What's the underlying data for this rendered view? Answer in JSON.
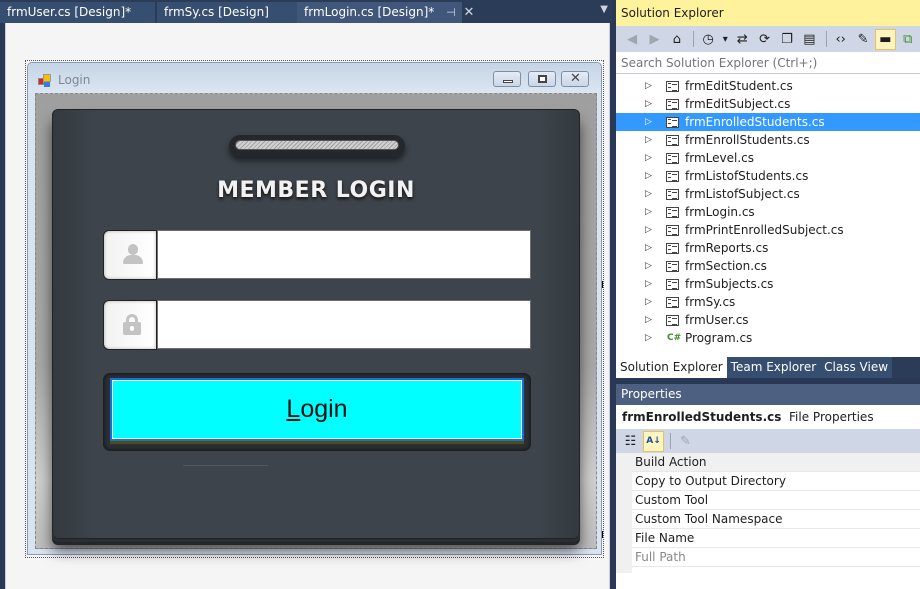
{
  "doc_tabs": [
    {
      "label": "frmUser.cs [Design]*",
      "active": false
    },
    {
      "label": "frmSy.cs [Design]",
      "active": false
    },
    {
      "label": "frmLogin.cs [Design]*",
      "active": true
    }
  ],
  "doc_tab_icons": {
    "pin": "pin-icon",
    "close": "close-icon",
    "overflow": "dropdown-icon"
  },
  "form": {
    "title": "Login",
    "heading": "MEMBER LOGIN",
    "username_value": "",
    "password_value": "",
    "login_button": {
      "mnemonic": "L",
      "rest": "ogin",
      "bg_color": "#00ffff"
    }
  },
  "solution_explorer": {
    "title": "Solution Explorer",
    "search_placeholder": "Search Solution Explorer (Ctrl+;)",
    "toolbar": [
      "back-icon",
      "forward-icon",
      "home-icon",
      "pending-changes-icon",
      "sync-icon",
      "refresh-icon",
      "collapse-all-icon",
      "show-all-files-icon",
      "view-code-icon",
      "properties-icon",
      "preview-icon",
      "class-diagram-icon"
    ],
    "items": [
      {
        "label": "frmEditStudent.cs",
        "type": "form",
        "selected": false
      },
      {
        "label": "frmEditSubject.cs",
        "type": "form",
        "selected": false
      },
      {
        "label": "frmEnrolledStudents.cs",
        "type": "form",
        "selected": true
      },
      {
        "label": "frmEnrollStudents.cs",
        "type": "form",
        "selected": false
      },
      {
        "label": "frmLevel.cs",
        "type": "form",
        "selected": false
      },
      {
        "label": "frmListofStudents.cs",
        "type": "form",
        "selected": false
      },
      {
        "label": "frmListofSubject.cs",
        "type": "form",
        "selected": false
      },
      {
        "label": "frmLogin.cs",
        "type": "form",
        "selected": false
      },
      {
        "label": "frmPrintEnrolledSubject.cs",
        "type": "form",
        "selected": false
      },
      {
        "label": "frmReports.cs",
        "type": "form",
        "selected": false
      },
      {
        "label": "frmSection.cs",
        "type": "form",
        "selected": false
      },
      {
        "label": "frmSubjects.cs",
        "type": "form",
        "selected": false
      },
      {
        "label": "frmSy.cs",
        "type": "form",
        "selected": false
      },
      {
        "label": "frmUser.cs",
        "type": "form",
        "selected": false
      },
      {
        "label": "Program.cs",
        "type": "csharp",
        "selected": false
      }
    ],
    "bottom_tabs": [
      {
        "label": "Solution Explorer",
        "active": true
      },
      {
        "label": "Team Explorer",
        "active": false
      },
      {
        "label": "Class View",
        "active": false
      }
    ]
  },
  "properties": {
    "title": "Properties",
    "object_name": "frmEnrolledStudents.cs",
    "object_type": "File Properties",
    "rows": [
      {
        "label": "Build Action",
        "muted": false
      },
      {
        "label": "Copy to Output Directory",
        "muted": false
      },
      {
        "label": "Custom Tool",
        "muted": false
      },
      {
        "label": "Custom Tool Namespace",
        "muted": false
      },
      {
        "label": "File Name",
        "muted": false
      },
      {
        "label": "Full Path",
        "muted": true
      }
    ]
  },
  "glyphs": {
    "tab_pin": "⊣",
    "tab_close": "✕",
    "overflow": "▼",
    "tree_arrow": "▷",
    "cs_badge": "C#",
    "close_x": "✕",
    "tb_back": "◀",
    "tb_fwd": "▶",
    "tb_home": "⌂",
    "tb_clock": "◷",
    "tb_caret": "▾",
    "tb_sync": "⇄",
    "tb_refresh": "⟳",
    "tb_collapse": "❐",
    "tb_showall": "▤",
    "tb_code": "‹›",
    "tb_wrench": "✎",
    "tb_preview": "▬",
    "tb_diagram": "⧉",
    "pg_categorized": "☷",
    "pg_alpha": "A↓",
    "pg_pages": "✎"
  }
}
